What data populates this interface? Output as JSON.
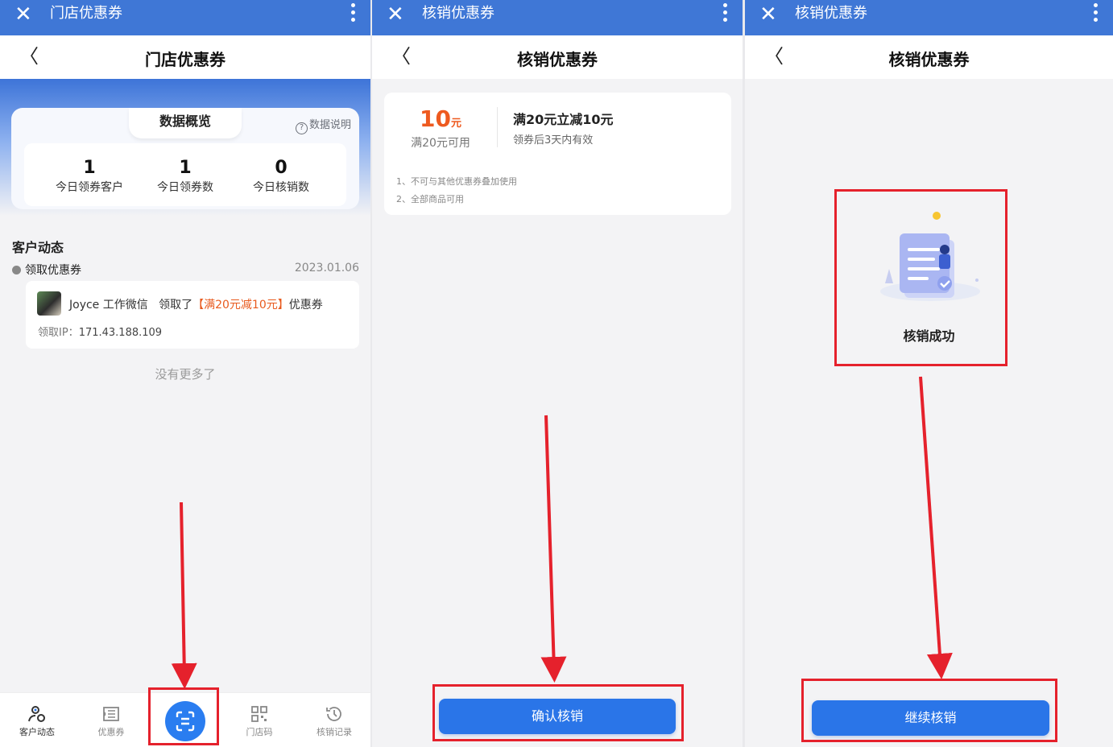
{
  "panel1": {
    "topbar": {
      "close": "✕",
      "title": "门店优惠券"
    },
    "navbar": {
      "back": "〈",
      "title": "门店优惠券"
    },
    "overview": {
      "tab": "数据概览",
      "help": "数据说明",
      "stats": [
        {
          "value": "1",
          "label": "今日领券客户"
        },
        {
          "value": "1",
          "label": "今日领券数"
        },
        {
          "value": "0",
          "label": "今日核销数"
        }
      ]
    },
    "activity": {
      "section_title": "客户动态",
      "event": "领取优惠券",
      "date": "2023.01.06",
      "user": "Joyce 工作微信",
      "action": "领取了",
      "coupon": "【满20元减10元】",
      "suffix": "优惠券",
      "ip_label": "领取IP：",
      "ip_value": "171.43.188.109"
    },
    "no_more": "没有更多了",
    "tabs": [
      {
        "label": "客户动态",
        "icon": "customer-activity-icon"
      },
      {
        "label": "优惠券",
        "icon": "coupon-icon"
      },
      {
        "label": "",
        "icon": "scan-icon"
      },
      {
        "label": "门店码",
        "icon": "qr-code-icon"
      },
      {
        "label": "核销记录",
        "icon": "history-icon"
      }
    ]
  },
  "panel2": {
    "topbar": {
      "close": "✕",
      "title": "核销优惠券"
    },
    "navbar": {
      "back": "〈",
      "title": "核销优惠券"
    },
    "coupon": {
      "amount": "10",
      "unit": "元",
      "min": "满20元可用",
      "name": "满20元立减10元",
      "validity": "领券后3天内有效",
      "rules": [
        "1、不可与其他优惠券叠加使用",
        "2、全部商品可用"
      ]
    },
    "confirm_button": "确认核销"
  },
  "panel3": {
    "topbar": {
      "close": "✕",
      "title": "核销优惠券"
    },
    "navbar": {
      "back": "〈",
      "title": "核销优惠券"
    },
    "success_text": "核销成功",
    "continue_button": "继续核销"
  },
  "colors": {
    "brand_blue": "#3f77d6",
    "button_blue": "#2a75e8",
    "accent_orange": "#ee5a1f",
    "annotation_red": "#e5212c"
  }
}
